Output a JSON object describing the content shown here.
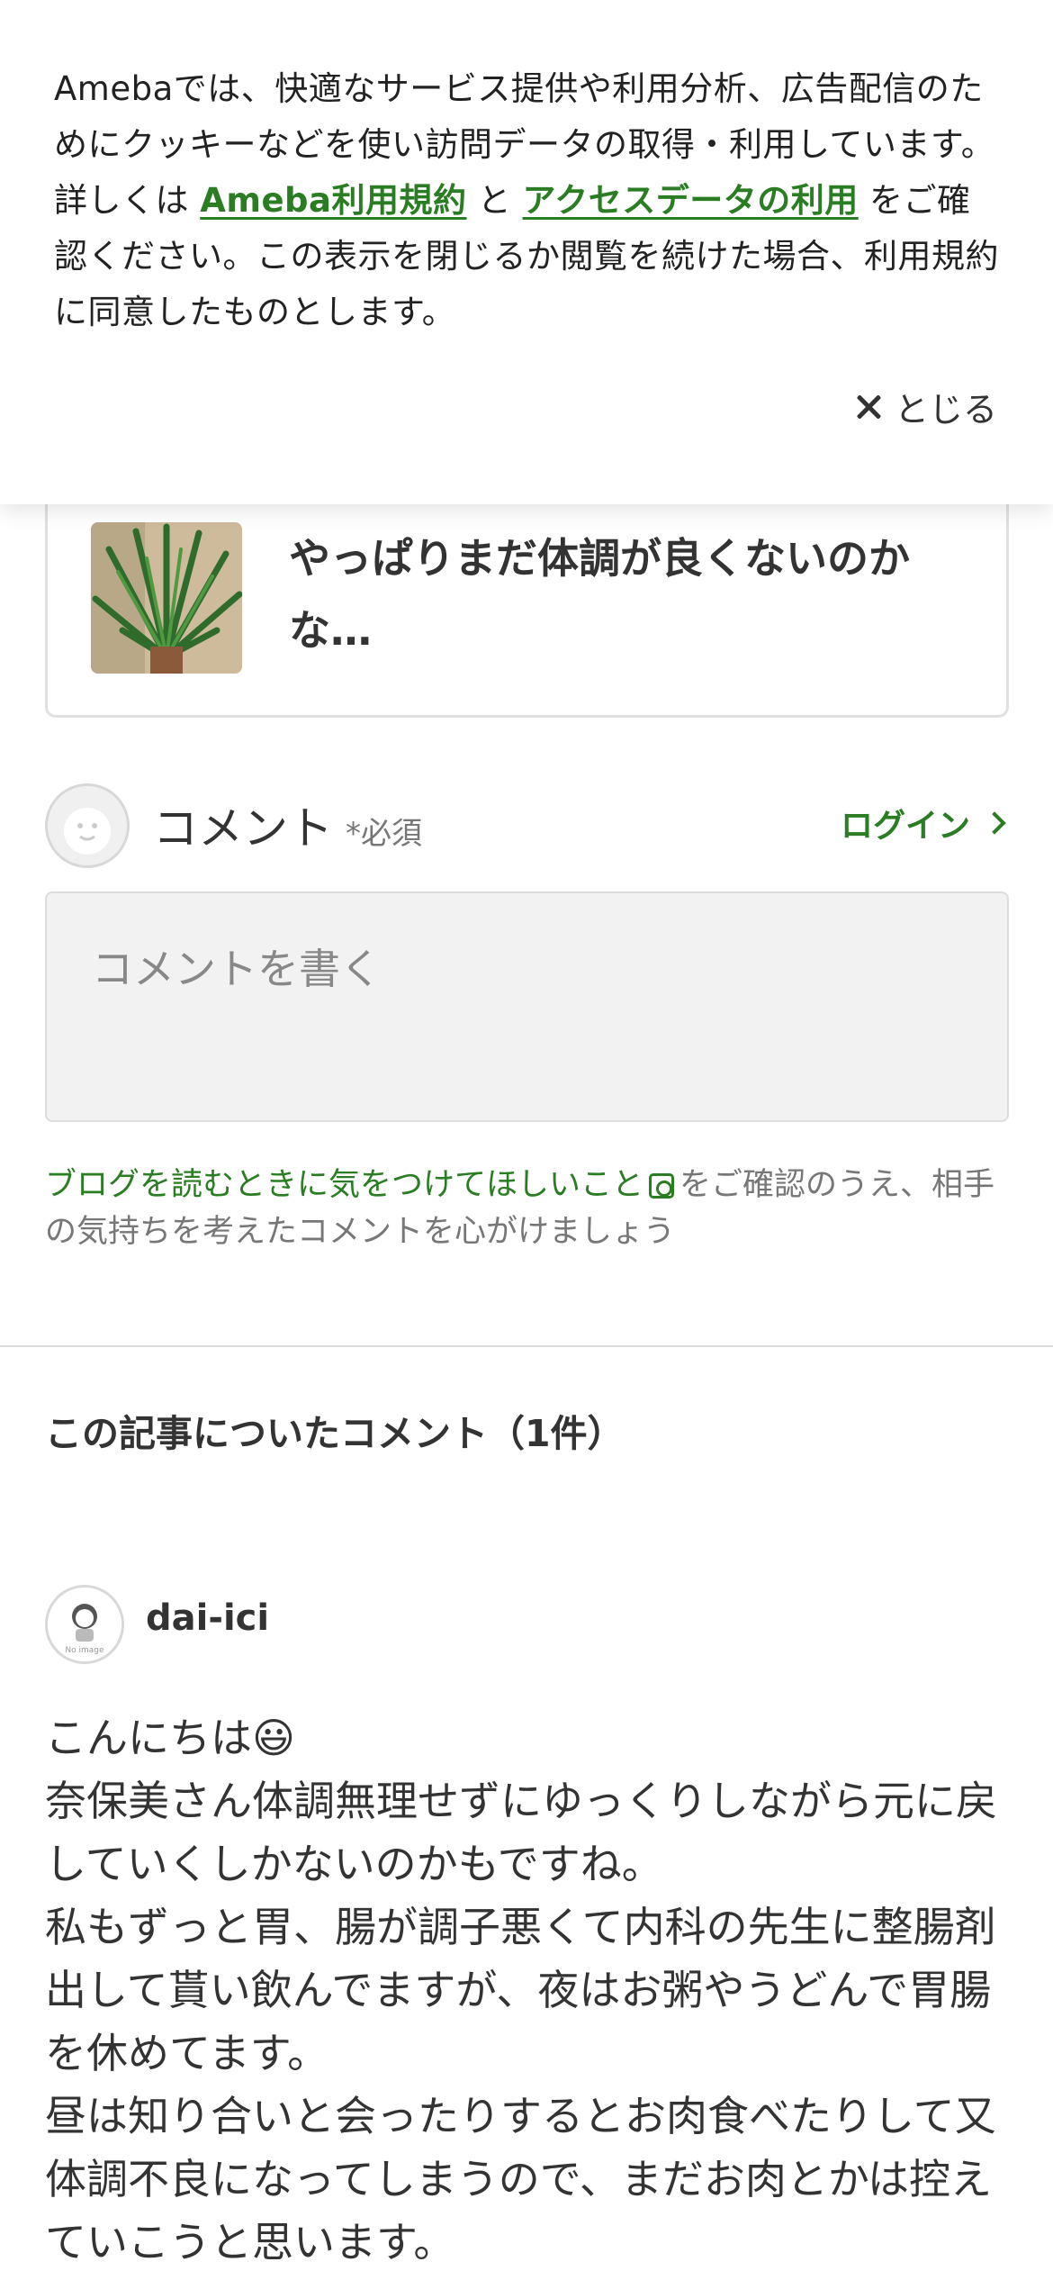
{
  "cookie_banner": {
    "text_before": "Amebaでは、快適なサービス提供や利用分析、広告配信のためにクッキーなどを使い訪問データの取得・利用しています。詳しくは ",
    "link_terms": "Ameba利用規約",
    "text_and": " と ",
    "link_access": "アクセスデータの利用",
    "text_after": " をご確認ください。この表示を閉じるか閲覧を続けた場合、利用規約に同意したものとします。",
    "close_label": "とじる"
  },
  "related_article": {
    "title": "やっぱりまだ体調が良くないのかな…"
  },
  "comment_form": {
    "label": "コメント",
    "required": "*必須",
    "login_label": "ログイン",
    "placeholder": "コメントを書く",
    "guide_link": "ブログを読むときに気をつけてほしいこと",
    "guide_text": "をご確認のうえ、相手の気持ちを考えたコメントを心がけましょう"
  },
  "comments_section": {
    "heading": "この記事についたコメント（1件）",
    "comments": [
      {
        "author": "dai-ici",
        "avatar_text": "No image",
        "lines": [
          "こんにちは😃",
          "奈保美さん体調無理せずにゆっくりしながら元に戻していくしかないのかもですね。",
          "私もずっと胃、腸が調子悪くて内科の先生に整腸剤出して貰い飲んでますが、夜はお粥やうどんで胃腸を休めてます。",
          "昼は知り合いと会ったりするとお肉食べたりして又体調不良になってしまうので、まだお肉とかは控えていこうと思います。"
        ]
      }
    ]
  },
  "colors": {
    "accent_green": "#2a7d22",
    "text": "#333333",
    "muted": "#777777"
  }
}
